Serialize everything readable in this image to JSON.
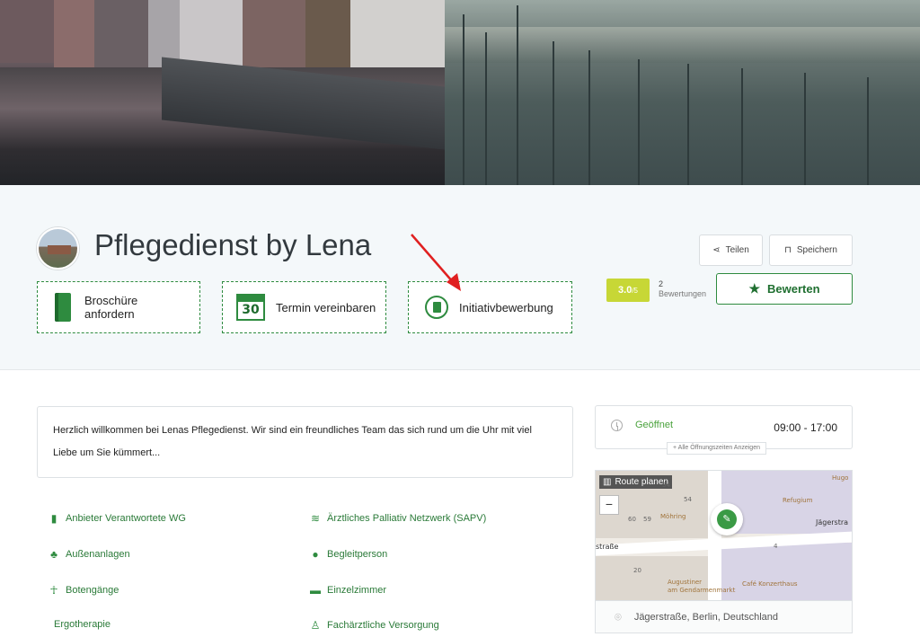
{
  "page": {
    "title": "Pflegedienst by Lena"
  },
  "actions": {
    "brochure": "Broschüre anfordern",
    "termin": "Termin vereinbaren",
    "termin_icon_number": "30",
    "initiativ": "Initiativbewerbung"
  },
  "header_buttons": {
    "share": "Teilen",
    "save": "Speichern"
  },
  "rating": {
    "score": "3.0",
    "max": "/5",
    "count": "2",
    "count_label": "Bewertungen",
    "rate_button": "Bewerten"
  },
  "description": "Herzlich willkommen bei Lenas Pflegedienst. Wir sind ein freundliches Team das sich rund um die Uhr mit viel Liebe um Sie kümmert...",
  "features": [
    {
      "icon": "building-icon",
      "label": "Anbieter Verantwortete WG"
    },
    {
      "icon": "wifi-icon",
      "label": "Ärztliches Palliativ Netzwerk (SAPV)"
    },
    {
      "icon": "tree-icon",
      "label": "Außenanlagen"
    },
    {
      "icon": "users-icon",
      "label": "Begleitperson"
    },
    {
      "icon": "walking-icon",
      "label": "Botengänge"
    },
    {
      "icon": "bed-icon",
      "label": "Einzelzimmer"
    },
    {
      "icon": "",
      "label": "Ergotherapie"
    },
    {
      "icon": "doctor-icon",
      "label": "Fachärztliche Versorgung"
    }
  ],
  "hours": {
    "status": "Geöffnet",
    "time": "09:00 - 17:00",
    "all_link": "Alle Öffnungszeiten Anzeigen"
  },
  "map": {
    "route_button": "Route planen",
    "zoom_out": "−",
    "labels": {
      "mohring": "Möhring",
      "refugium": "Refugium",
      "hug": "Hugo",
      "augustiner": "Augustiner\nam Gendarmenmarkt",
      "cafe": "Café Konzerthaus",
      "jaegerstr_top": "Jägerstra",
      "strasse_left": "straße"
    },
    "numbers": [
      "54",
      "60",
      "59",
      "54",
      "20",
      "4"
    ]
  },
  "address": "Jägerstraße, Berlin, Deutschland",
  "colors": {
    "green": "#2e8b3f",
    "rating_badge": "#c7d736",
    "band_bg": "#f4f8fa",
    "arrow": "#e02020"
  }
}
